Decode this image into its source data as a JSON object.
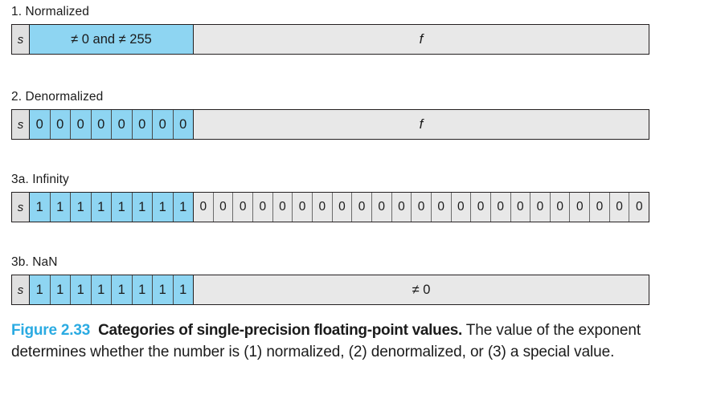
{
  "figure": {
    "sections": [
      {
        "title": "1. Normalized",
        "sign_label": "s",
        "exponent_label": "≠ 0 and ≠ 255",
        "exponent_bits": [],
        "fraction_label": "f",
        "fraction_bits": []
      },
      {
        "title": "2. Denormalized",
        "sign_label": "s",
        "exponent_label": "",
        "exponent_bits": [
          "0",
          "0",
          "0",
          "0",
          "0",
          "0",
          "0",
          "0"
        ],
        "fraction_label": "f",
        "fraction_bits": []
      },
      {
        "title": "3a. Infinity",
        "sign_label": "s",
        "exponent_label": "",
        "exponent_bits": [
          "1",
          "1",
          "1",
          "1",
          "1",
          "1",
          "1",
          "1"
        ],
        "fraction_label": "",
        "fraction_bits": [
          "0",
          "0",
          "0",
          "0",
          "0",
          "0",
          "0",
          "0",
          "0",
          "0",
          "0",
          "0",
          "0",
          "0",
          "0",
          "0",
          "0",
          "0",
          "0",
          "0",
          "0",
          "0",
          "0"
        ]
      },
      {
        "title": "3b. NaN",
        "sign_label": "s",
        "exponent_label": "",
        "exponent_bits": [
          "1",
          "1",
          "1",
          "1",
          "1",
          "1",
          "1",
          "1"
        ],
        "fraction_label": "≠ 0",
        "fraction_bits": []
      }
    ],
    "caption": {
      "figure_number": "Figure 2.33",
      "bold_title": "Categories of single-precision floating-point values.",
      "body": " The value of the exponent determines whether the number is (1) normalized, (2) denormalized, or (3) a special value."
    },
    "colors": {
      "exponent_fill": "#8ed5f2",
      "fraction_fill": "#e8e8e8",
      "sign_fill": "#e0e0e0",
      "border": "#231f20",
      "caption_accent": "#2babe2"
    }
  }
}
